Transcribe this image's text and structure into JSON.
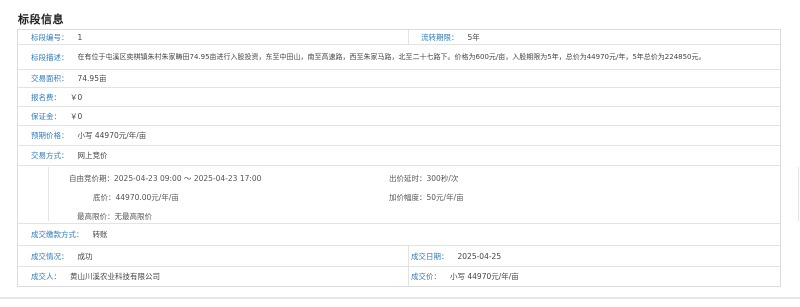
{
  "section_title": "标段信息",
  "rows": {
    "lot_no": {
      "label": "标段编号：",
      "value": "1"
    },
    "transfer_term": {
      "label": "流转期限：",
      "value": "5年"
    },
    "description": {
      "label": "标段描述：",
      "value": "在有位于屯溪区奕棋镇朱村朱家畴田74.95亩进行入股投资，东至中田山，南至高速路，西至朱家马路，北至二十七路下。价格为600元/亩，入股期限为5年，总价为44970元/年，5年总价为224850元。"
    },
    "area": {
      "label": "交易面积：",
      "value": "74.95亩"
    },
    "registration_fee": {
      "label": "报名费：",
      "value": "￥0"
    },
    "deposit": {
      "label": "保证金：",
      "value": "￥0"
    },
    "expected_price": {
      "label": "预期价格：",
      "value": "小写 44970元/年/亩"
    },
    "trade_method": {
      "label": "交易方式：",
      "value": "网上竞价"
    }
  },
  "bidding": {
    "free_period_label": "自由竞价期：",
    "free_period_value": "2025-04-23 09:00 ～ 2025-04-23 17:00",
    "bid_delay_label": "出价延时：",
    "bid_delay_value": "300秒/次",
    "base_price_label": "底价：",
    "base_price_value": "44970.00元/年/亩",
    "increment_label": "加价幅度：",
    "increment_value": "50元/年/亩",
    "max_price_label": "最高限价：",
    "max_price_value": "无最高限价"
  },
  "deal": {
    "payment": {
      "label": "成交缴款方式：",
      "value": "转账"
    },
    "status": {
      "label": "成交情况：",
      "value": "成功"
    },
    "date": {
      "label": "成交日期：",
      "value": "2025-04-25"
    },
    "buyer": {
      "label": "成交人：",
      "value": "黄山川溪农业科技有限公司"
    },
    "price": {
      "label": "成交价：",
      "value": "小写 44970元/年/亩"
    }
  }
}
